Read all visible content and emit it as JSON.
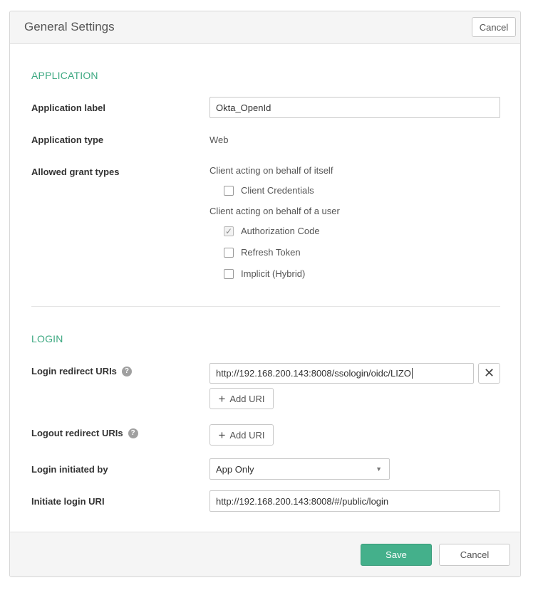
{
  "header": {
    "title": "General Settings",
    "cancel_label": "Cancel"
  },
  "application": {
    "section_title": "APPLICATION",
    "label_field": {
      "label": "Application label",
      "value": "Okta_OpenId"
    },
    "type_field": {
      "label": "Application type",
      "value": "Web"
    },
    "grant_types": {
      "label": "Allowed grant types",
      "group_itself": "Client acting on behalf of itself",
      "group_user": "Client acting on behalf of a user",
      "options": [
        {
          "label": "Client Credentials",
          "checked": false
        },
        {
          "label": "Authorization Code",
          "checked": true
        },
        {
          "label": "Refresh Token",
          "checked": false
        },
        {
          "label": "Implicit (Hybrid)",
          "checked": false
        }
      ]
    }
  },
  "login": {
    "section_title": "LOGIN",
    "redirect_uris": {
      "label": "Login redirect URIs",
      "values": [
        "http://192.168.200.143:8008/ssologin/oidc/LIZO"
      ],
      "add_label": "Add URI"
    },
    "logout_uris": {
      "label": "Logout redirect URIs",
      "add_label": "Add URI"
    },
    "initiated_by": {
      "label": "Login initiated by",
      "selected": "App Only"
    },
    "initiate_uri": {
      "label": "Initiate login URI",
      "value": "http://192.168.200.143:8008/#/public/login"
    }
  },
  "footer": {
    "save_label": "Save",
    "cancel_label": "Cancel"
  },
  "colors": {
    "accent": "#3ea982",
    "save_button": "#44b08b"
  },
  "icons": {
    "help": "help-icon",
    "remove": "close-icon",
    "add": "plus-icon",
    "dropdown": "chevron-down-icon",
    "check": "check-icon"
  }
}
